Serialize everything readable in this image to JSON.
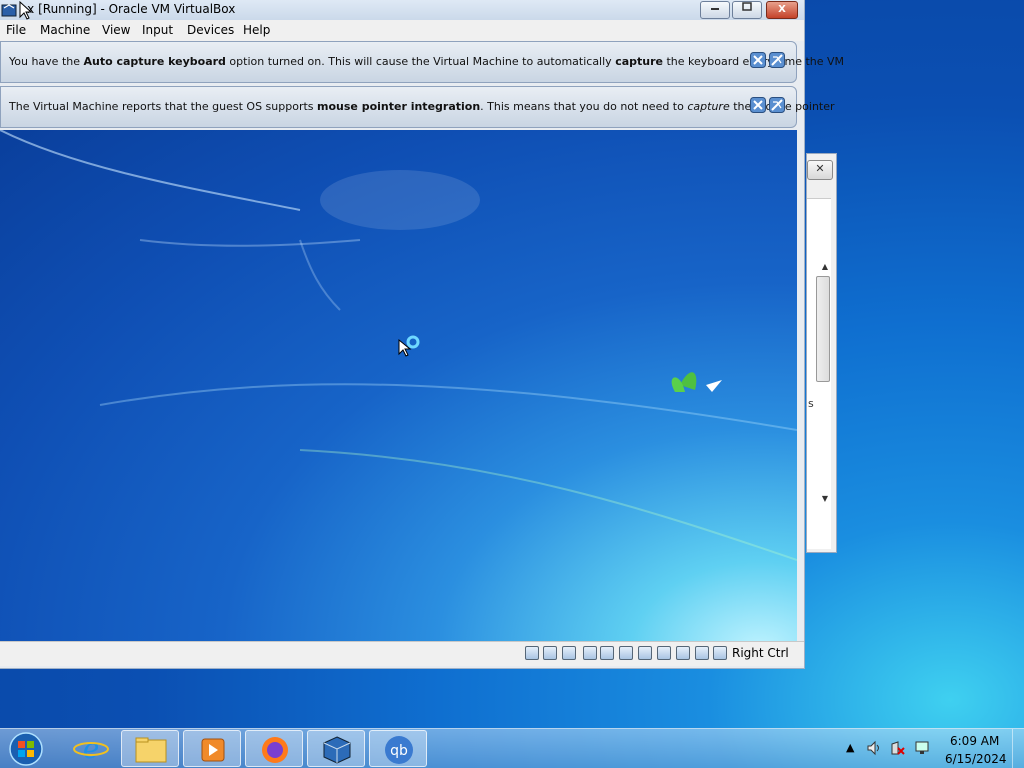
{
  "window": {
    "title": "ex [Running] - Oracle VM VirtualBox",
    "minimize_label": "▭",
    "maximize_label": "□",
    "close_label": "X"
  },
  "menu": [
    "File",
    "Machine",
    "View",
    "Input",
    "Devices",
    "Help"
  ],
  "notices": [
    {
      "parts": [
        {
          "t": "You have the "
        },
        {
          "t": "Auto capture keyboard",
          "b": true
        },
        {
          "t": " option turned on. This will cause the Virtual Machine to automatically "
        },
        {
          "t": "capture",
          "b": true
        },
        {
          "t": " the keyboard every time the VM"
        }
      ]
    },
    {
      "parts": [
        {
          "t": "The Virtual Machine reports that the guest OS supports "
        },
        {
          "t": "mouse pointer integration",
          "b": true
        },
        {
          "t": ". This means that you do not need to "
        },
        {
          "t": "capture",
          "i": true
        },
        {
          "t": " the mouse pointer"
        }
      ]
    }
  ],
  "statusbar": {
    "host_key": "Right Ctrl",
    "icons": [
      "hard-disk-icon",
      "optical-drive-icon",
      "audio-icon",
      "network-icon",
      "usb-icon",
      "shared-folder-icon",
      "display-icon",
      "video-capture-icon",
      "cpu-icon",
      "mouse-integration-icon",
      "host-key-icon"
    ]
  },
  "background_window": {
    "letter": "s"
  },
  "taskbar": {
    "apps": [
      "internet-explorer",
      "file-explorer",
      "media-player",
      "firefox",
      "virtualbox",
      "qbittorrent"
    ],
    "clock_time": "6:09 AM",
    "clock_date": "6/15/2024",
    "tray_chevron": "▲"
  },
  "colors": {
    "desktop": "#0b4fb2",
    "titlebar": "#cbd9ea",
    "notice": "#d5dfeb"
  }
}
